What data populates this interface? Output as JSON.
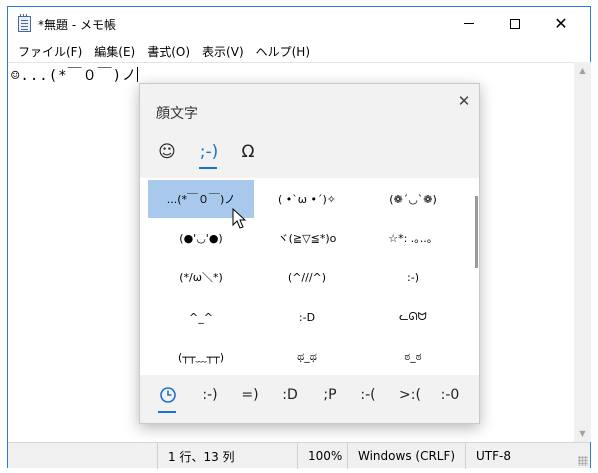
{
  "window": {
    "title": "*無題 - メモ帳"
  },
  "menu": [
    "ファイル(F)",
    "編集(E)",
    "書式(O)",
    "表示(V)",
    "ヘルプ(H)"
  ],
  "editor": {
    "text": "☺...(*￣０￣)ノ"
  },
  "statusbar": {
    "position": "1 行、13 列",
    "zoom": "100%",
    "line_ending": "Windows (CRLF)",
    "encoding": "UTF-8"
  },
  "panel": {
    "title": "顔文字",
    "category_tabs": [
      "☺",
      ";-)",
      "Ω"
    ],
    "active_category": ";-)",
    "kaomoji": [
      "...(*￣０￣)ノ",
      "( •`ω •´)✧",
      "(❁´◡`❁)",
      "(●'◡'●)",
      "ヾ(≧▽≦*)o",
      "☆*: .｡..。",
      "(*/ω＼*)",
      "(^///^)",
      ":-)",
      "^_^",
      ":-D",
      "ᓚᘏᗢ",
      "(┬┬﹏┬┬)",
      "ಥ_ಥ",
      "ಠ_ಠ"
    ],
    "selected_index": 0,
    "subtabs": [
      "recent-icon",
      ":-)",
      "=)",
      ":D",
      ";P",
      ":-(",
      ">:(",
      ":-0"
    ]
  },
  "colors": {
    "window_border": "#2b7bd3",
    "accent": "#1a73c9",
    "selection": "#a8c9ec"
  },
  "icons": [
    "notepad-icon",
    "minimize-icon",
    "maximize-icon",
    "close-icon",
    "panel-close-icon",
    "clock-icon",
    "mouse-cursor-icon"
  ]
}
